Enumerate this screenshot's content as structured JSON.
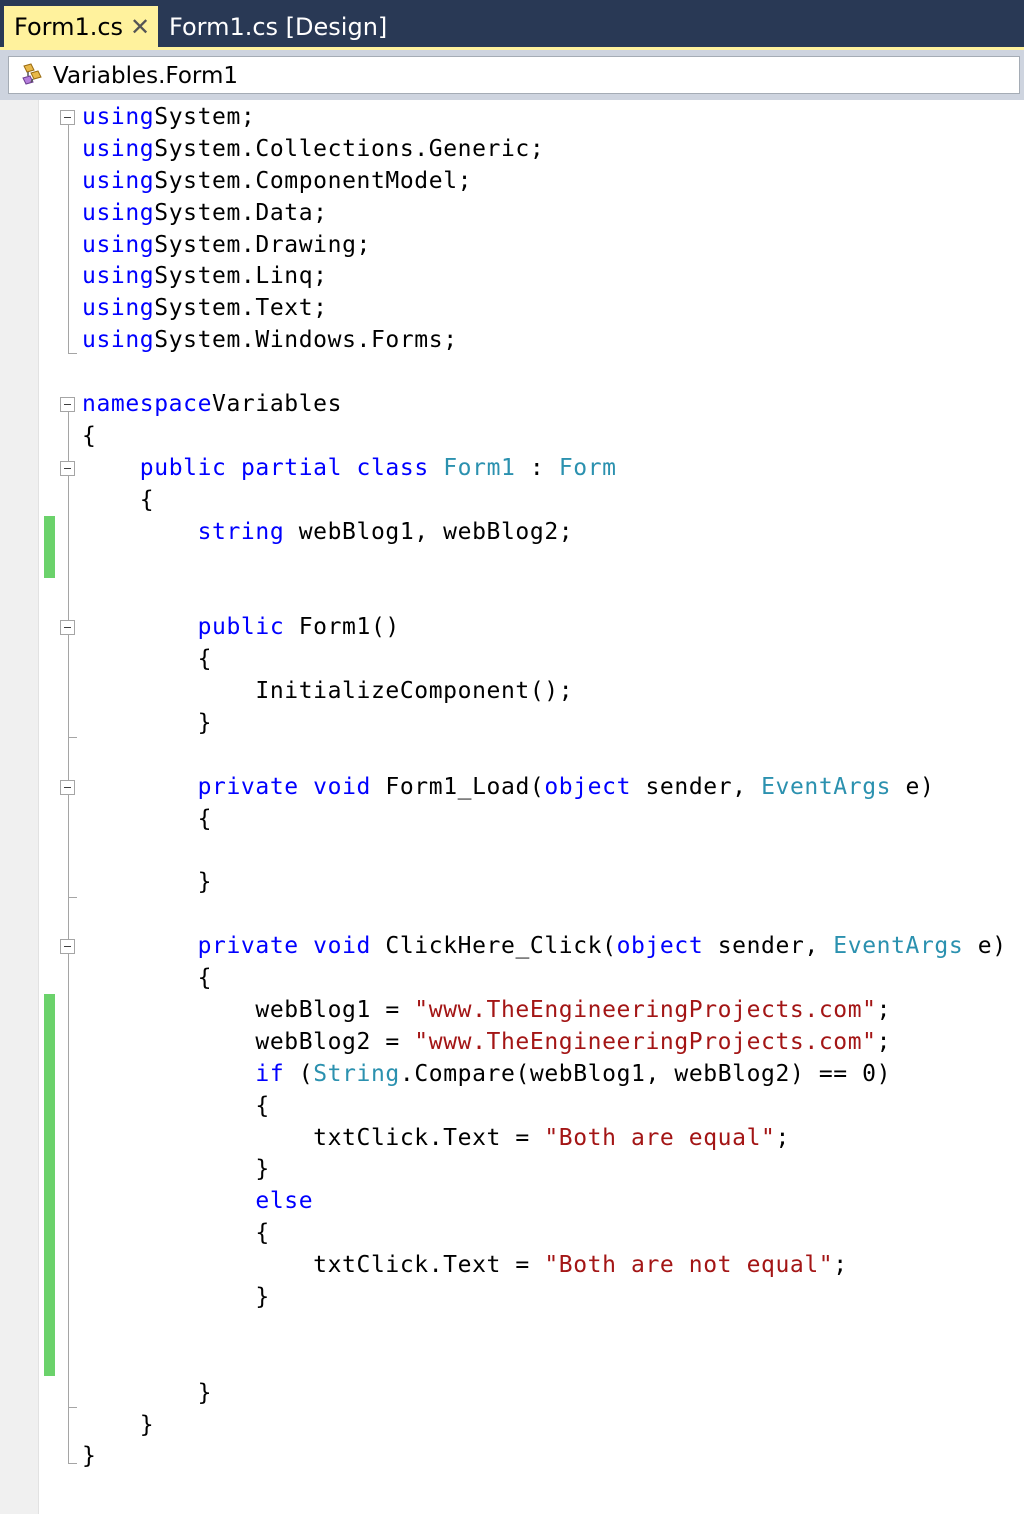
{
  "tabs": [
    {
      "label": "Form1.cs",
      "active": true,
      "close_icon": "close-icon"
    },
    {
      "label": "Form1.cs [Design]",
      "active": false
    }
  ],
  "navigation": {
    "icon": "class-icon",
    "label": "Variables.Form1"
  },
  "colors": {
    "tab_strip": "#293955",
    "active_tab": "#fff29d",
    "keyword": "#0000ff",
    "type": "#2b91af",
    "string": "#a31515",
    "changed_line_marker": "#6bd26b"
  },
  "code_lines": [
    [
      [
        "kw",
        "using"
      ],
      [
        "",
        "System;"
      ]
    ],
    [
      [
        "kw",
        "using"
      ],
      [
        "",
        "System.Collections.Generic;"
      ]
    ],
    [
      [
        "kw",
        "using"
      ],
      [
        "",
        "System.ComponentModel;"
      ]
    ],
    [
      [
        "kw",
        "using"
      ],
      [
        "",
        "System.Data;"
      ]
    ],
    [
      [
        "kw",
        "using"
      ],
      [
        "",
        "System.Drawing;"
      ]
    ],
    [
      [
        "kw",
        "using"
      ],
      [
        "",
        "System.Linq;"
      ]
    ],
    [
      [
        "kw",
        "using"
      ],
      [
        "",
        "System.Text;"
      ]
    ],
    [
      [
        "kw",
        "using"
      ],
      [
        "",
        "System.Windows.Forms;"
      ]
    ],
    [],
    [
      [
        "kw",
        "namespace"
      ],
      [
        "",
        "Variables"
      ]
    ],
    [
      [
        "",
        "{"
      ]
    ],
    [
      [
        "",
        "    "
      ],
      [
        "kw",
        "public"
      ],
      [
        "",
        " "
      ],
      [
        "kw",
        "partial"
      ],
      [
        "",
        " "
      ],
      [
        "kw",
        "class"
      ],
      [
        "",
        " "
      ],
      [
        "typ",
        "Form1"
      ],
      [
        "",
        " : "
      ],
      [
        "typ",
        "Form"
      ]
    ],
    [
      [
        "",
        "    {"
      ]
    ],
    [
      [
        "",
        "        "
      ],
      [
        "kw",
        "string"
      ],
      [
        "",
        " webBlog1, webBlog2;"
      ]
    ],
    [],
    [],
    [
      [
        "",
        "        "
      ],
      [
        "kw",
        "public"
      ],
      [
        "",
        " Form1()"
      ]
    ],
    [
      [
        "",
        "        {"
      ]
    ],
    [
      [
        "",
        "            InitializeComponent();"
      ]
    ],
    [
      [
        "",
        "        }"
      ]
    ],
    [],
    [
      [
        "",
        "        "
      ],
      [
        "kw",
        "private"
      ],
      [
        "",
        " "
      ],
      [
        "kw",
        "void"
      ],
      [
        "",
        " Form1_Load("
      ],
      [
        "kw",
        "object"
      ],
      [
        "",
        " sender, "
      ],
      [
        "typ",
        "EventArgs"
      ],
      [
        "",
        " e)"
      ]
    ],
    [
      [
        "",
        "        {"
      ]
    ],
    [],
    [
      [
        "",
        "        }"
      ]
    ],
    [],
    [
      [
        "",
        "        "
      ],
      [
        "kw",
        "private"
      ],
      [
        "",
        " "
      ],
      [
        "kw",
        "void"
      ],
      [
        "",
        " ClickHere_Click("
      ],
      [
        "kw",
        "object"
      ],
      [
        "",
        " sender, "
      ],
      [
        "typ",
        "EventArgs"
      ],
      [
        "",
        " e)"
      ]
    ],
    [
      [
        "",
        "        {"
      ]
    ],
    [
      [
        "",
        "            webBlog1 = "
      ],
      [
        "str",
        "\"www.TheEngineeringProjects.com\""
      ],
      [
        "",
        ";"
      ]
    ],
    [
      [
        "",
        "            webBlog2 = "
      ],
      [
        "str",
        "\"www.TheEngineeringProjects.com\""
      ],
      [
        "",
        ";"
      ]
    ],
    [
      [
        "",
        "            "
      ],
      [
        "kw",
        "if"
      ],
      [
        "",
        " ("
      ],
      [
        "typ",
        "String"
      ],
      [
        "",
        ".Compare(webBlog1, webBlog2) == 0)"
      ]
    ],
    [
      [
        "",
        "            {"
      ]
    ],
    [
      [
        "",
        "                txtClick.Text = "
      ],
      [
        "str",
        "\"Both are equal\""
      ],
      [
        "",
        ";"
      ]
    ],
    [
      [
        "",
        "            }"
      ]
    ],
    [
      [
        "",
        "            "
      ],
      [
        "kw",
        "else"
      ]
    ],
    [
      [
        "",
        "            {"
      ]
    ],
    [
      [
        "",
        "                txtClick.Text = "
      ],
      [
        "str",
        "\"Both are not equal\""
      ],
      [
        "",
        ";"
      ]
    ],
    [
      [
        "",
        "            }"
      ]
    ],
    [],
    [],
    [
      [
        "",
        "        }"
      ]
    ],
    [
      [
        "",
        "    }"
      ]
    ],
    [
      [
        "",
        "}"
      ]
    ]
  ]
}
